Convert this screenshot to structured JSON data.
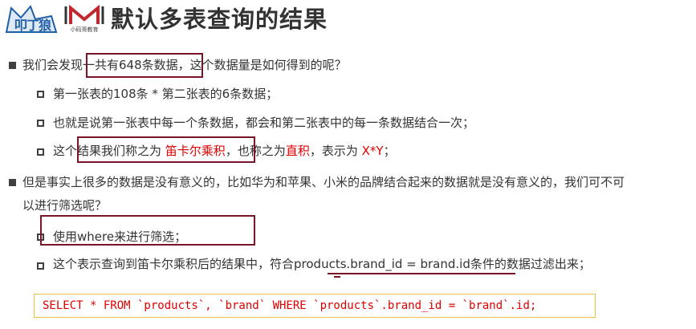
{
  "logo": {
    "fox_text": "叩丁狼",
    "m_text": "小码哥教育"
  },
  "title": "默认多表查询的结果",
  "points": [
    {
      "pre": "我们会发现",
      "boxed": "一共有648条数据",
      "post": "，这个数据量是如何得到的呢？",
      "subs": [
        {
          "text": "第一张表的108条 * 第二张表的6条数据；"
        },
        {
          "text": "也就是说第一张表中每一个条数据，都会和第二张表中的每一条数据结合一次；"
        },
        {
          "pre": "这个",
          "boxed": "结果我们称之为 ",
          "red1": "笛卡尔乘积",
          "mid": "，也称之为",
          "red2": "直积",
          "mid2": "，表示为 ",
          "red3": "X*Y",
          "post": "；"
        }
      ]
    },
    {
      "line1": "但是事实上很多的数据是没有意义的，比如华为和苹果、小米的品牌结合起来的数据就是没有意义的，我们可不可",
      "line2": "以进行筛选呢？",
      "subs": [
        {
          "text": "使用where来进行筛选；"
        },
        {
          "pre": "这个表示查询到笛卡尔乘积后的结果中，符合",
          "cond": "products.brand_id = brand.id",
          "post": "条件的数据过滤出来；"
        }
      ]
    }
  ],
  "code": "SELECT * FROM `products`, `brand` WHERE `products`.brand_id = `brand`.id;",
  "colors": {
    "accent_red": "#e00000",
    "highlight_box": "#7a1428",
    "code_border": "#e8c24a",
    "logo_blue": "#1e5fa8"
  }
}
